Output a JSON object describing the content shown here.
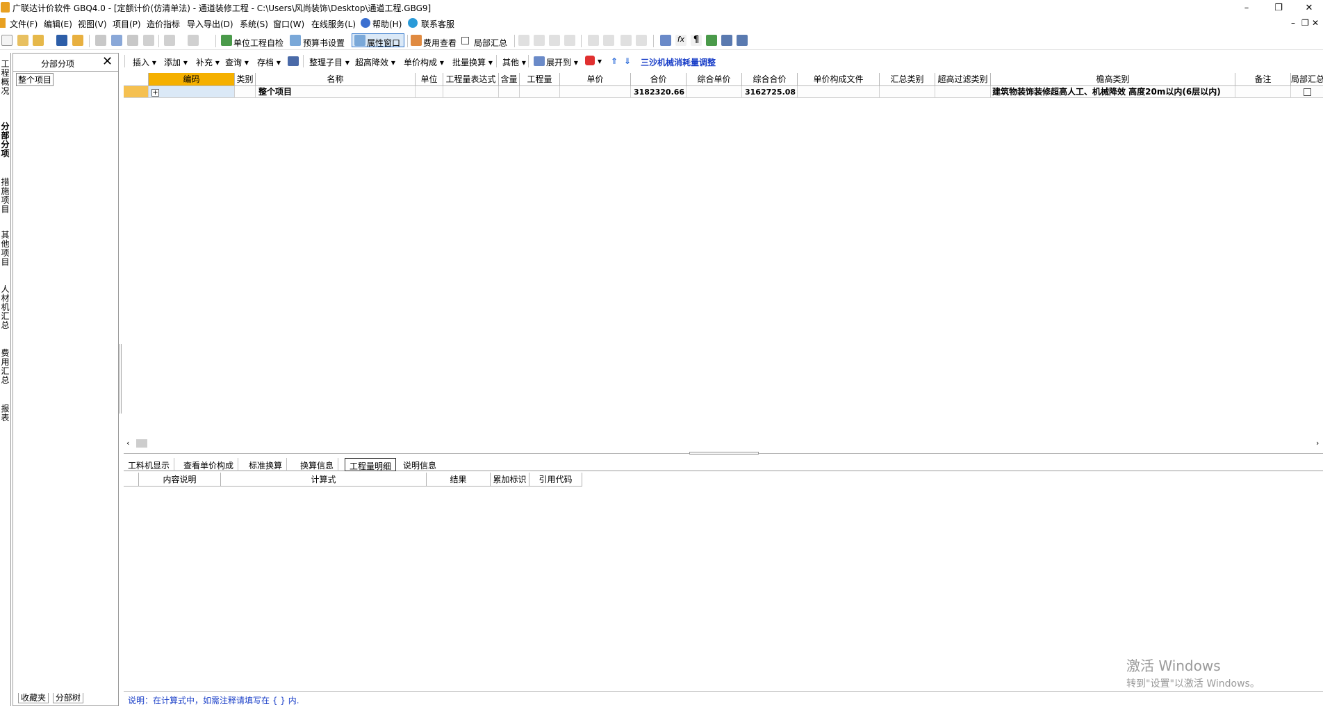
{
  "titlebar": {
    "title": "广联达计价软件 GBQ4.0 - [定额计价(仿清单法) - 通道装修工程 - C:\\Users\\风尚装饰\\Desktop\\通道工程.GBG9]",
    "minimize": "–",
    "restore": "❐",
    "close": "✕"
  },
  "menubar": {
    "items": [
      "文件(F)",
      "编辑(E)",
      "视图(V)",
      "项目(P)",
      "造价指标",
      "导入导出(D)",
      "系统(S)",
      "窗口(W)",
      "在线服务(L)",
      "帮助(H)",
      "联系客服"
    ],
    "right_min": "–",
    "right_restore": "❐",
    "right_close": "✕"
  },
  "toolbar1": {
    "self_check": "单位工程自检",
    "budget_settings": "预算书设置",
    "attr_window": "属性窗口",
    "fee_view": "费用查看",
    "local_summary": "局部汇总"
  },
  "left_tabs": [
    "工程概况",
    "分部分项",
    "措施项目",
    "其他项目",
    "人材机汇总",
    "费用汇总",
    "报表"
  ],
  "left_panel": {
    "title": "分部分项",
    "close": "✕",
    "tree_root": "整个项目",
    "bottom_tab1": "收藏夹",
    "bottom_tab2": "分部树"
  },
  "toolbar2": {
    "items": [
      "插入",
      "添加",
      "补充",
      "查询",
      "存档",
      "整理子目",
      "超高降效",
      "单价构成",
      "批量换算",
      "其他",
      "展开到"
    ],
    "link": "三沙机械消耗量调整"
  },
  "grid": {
    "headers": [
      "",
      "编码",
      "类别",
      "名称",
      "单位",
      "工程量表达式",
      "含量",
      "工程量",
      "单价",
      "合价",
      "综合单价",
      "综合合价",
      "单价构成文件",
      "汇总类别",
      "超高过滤类别",
      "檐高类别",
      "备注",
      "局部汇总"
    ],
    "row": {
      "expand": "+",
      "name": "整个项目",
      "total": "3182320.66",
      "comp_total": "3162725.08",
      "eaves": "建筑物装饰装修超高人工、机械降效 高度20m以内(6层以内)"
    }
  },
  "bottom_tabs": [
    "工料机显示",
    "查看单价构成",
    "标准换算",
    "换算信息",
    "工程量明细",
    "说明信息"
  ],
  "bottom_grid": {
    "headers": [
      "",
      "内容说明",
      "计算式",
      "结果",
      "累加标识",
      "引用代码"
    ]
  },
  "status": {
    "text": "说明：在计算式中，如需注释请填写在 { } 内."
  },
  "watermark": {
    "line1": "激活 Windows",
    "line2": "转到\"设置\"以激活 Windows。"
  },
  "colors": {
    "accent_orange": "#f5b000",
    "row_highlight": "#dbe9f7",
    "link_blue": "#1a3fc8"
  }
}
